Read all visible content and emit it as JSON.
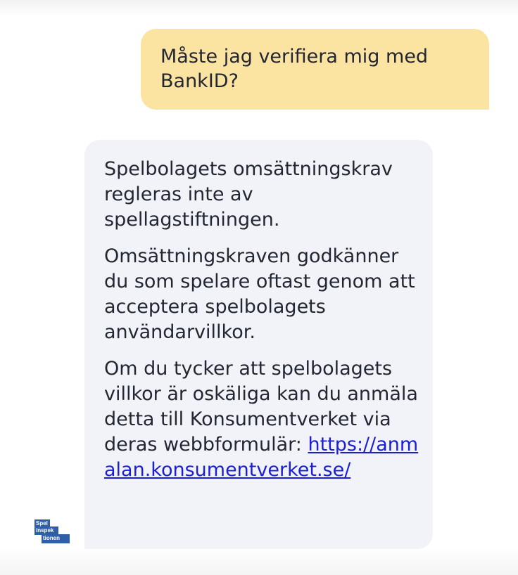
{
  "conversation": {
    "user_message": "Måste jag verifiera mig med BankID?",
    "bot_message": {
      "paragraphs": [
        "Spelbolagets omsättningskrav regleras inte av spellagstiftningen.",
        "Omsättningskraven godkänner du som spelare oftast genom att acceptera spelbolagets användarvillkor.",
        "Om du tycker att spelbolagets villkor är oskäliga kan du anmäla detta till Konsumentverket via deras webbformulär:"
      ],
      "link_text": "https://anmalan.konsumentverket.se/",
      "link_color": "#1a1fd6"
    }
  },
  "logo": {
    "line1": "Spel",
    "line2": "inspek",
    "line3": "tionen",
    "color": "#2f5fa8"
  },
  "colors": {
    "user_bubble": "#fbe3a1",
    "bot_bubble": "#f2f3f8"
  }
}
